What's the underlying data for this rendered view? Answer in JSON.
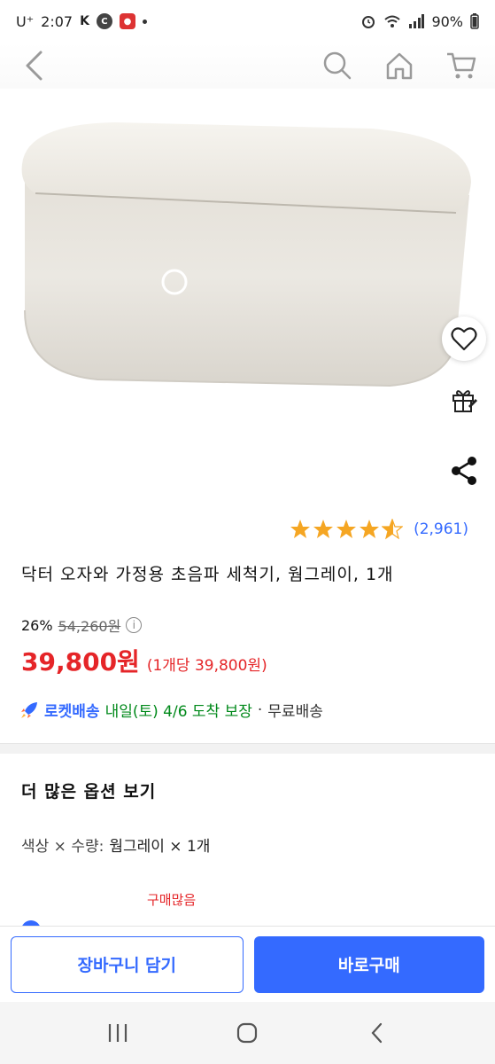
{
  "status_bar": {
    "carrier": "U⁺",
    "time": "2:07",
    "battery": "90%",
    "icons": [
      "vpn-key-icon",
      "c-app-icon",
      "notification-app-icon",
      "dot-icon",
      "alarm-icon",
      "wifi-icon",
      "signal-icon",
      "battery-icon"
    ]
  },
  "nav": {
    "icons": [
      "back-arrow-icon",
      "search-icon",
      "home-icon",
      "cart-icon"
    ]
  },
  "product": {
    "side_icons": [
      "heart-icon",
      "gift-icon",
      "share-icon"
    ],
    "rating_value": 4.5,
    "rating_count": "(2,961)",
    "title": "닥터 오자와 가정용 초음파 세척기, 웜그레이, 1개",
    "discount_rate": "26%",
    "original_price": "54,260원",
    "sale_price": "39,800원",
    "unit_price": "(1개당 39,800원)",
    "delivery": {
      "rocket_label": "로켓배송",
      "date_text": "내일(토) 4/6 도착 보장",
      "separator": "·",
      "free_shipping": "무료배송"
    }
  },
  "options": {
    "title": "더 많은 옵션 보기",
    "selected_label": "색상 × 수량:",
    "selected_value": "웜그레이 × 1개",
    "popular_badge": "구매많음"
  },
  "buy_bar": {
    "cart_label": "장바구니 담기",
    "buy_label": "바로구매"
  },
  "system_nav": {
    "icons": [
      "recent-apps-icon",
      "home-circle-icon",
      "back-chevron-icon"
    ]
  },
  "colors": {
    "accent": "#346aff",
    "price_red": "#e52528",
    "delivery_green": "#00891a",
    "star_gold": "#f5a623"
  }
}
